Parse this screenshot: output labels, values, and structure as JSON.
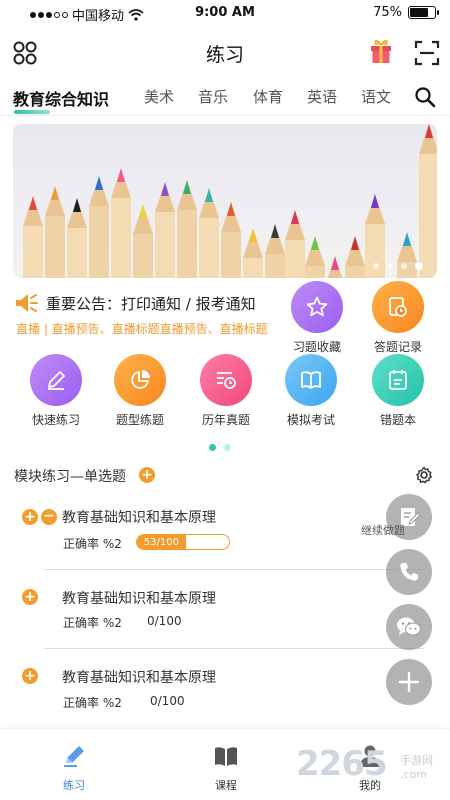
{
  "status_bar": {
    "carrier": "中国移动",
    "time": "9:00 AM",
    "battery": "75%"
  },
  "header": {
    "title": "练习"
  },
  "tabs": [
    {
      "label": "教育综合知识",
      "active": true
    },
    {
      "label": "美术"
    },
    {
      "label": "音乐"
    },
    {
      "label": "体育"
    },
    {
      "label": "英语"
    },
    {
      "label": "语文"
    }
  ],
  "banner": {
    "slides": 4,
    "active_slide": 4
  },
  "notice": {
    "text": "重要公告：打印通知 / 报考通知",
    "sub": "直播 | 直播预告、直播标题直播预告、直播标题"
  },
  "quick_actions": [
    {
      "label": "习题收藏",
      "icon": "star-icon",
      "color": "#a46cf0"
    },
    {
      "label": "答题记录",
      "icon": "record-icon",
      "color": "#f9962c"
    },
    {
      "label": "快速练习",
      "icon": "pencil-icon",
      "color": "#a46cf0"
    },
    {
      "label": "题型练题",
      "icon": "pie-chart-icon",
      "color": "#f9962c"
    },
    {
      "label": "历年真题",
      "icon": "history-icon",
      "color": "#f25d8c"
    },
    {
      "label": "模拟考试",
      "icon": "book-icon",
      "color": "#4fb4f3"
    },
    {
      "label": "错题本",
      "icon": "notebook-icon",
      "color": "#2fd0b6"
    }
  ],
  "section": {
    "title": "模块练习—单选题"
  },
  "practice_items": [
    {
      "title": "教育基础知识和基本原理",
      "rate": "正确率 %2",
      "count": "53/100",
      "progress": 0.53
    },
    {
      "title": "教育基础知识和基本原理",
      "rate": "正确率 %2",
      "count": "0/100"
    },
    {
      "title": "教育基础知识和基本原理",
      "rate": "正确率 %2",
      "count": "0/100"
    }
  ],
  "floating": {
    "continue_label": "继续做题"
  },
  "bottom_nav": [
    {
      "label": "练习",
      "active": true
    },
    {
      "label": "课程"
    },
    {
      "label": "我的"
    }
  ],
  "watermark": {
    "main": "2265",
    "sub": "手游网",
    "domain": ".com"
  },
  "colors": {
    "accent": "#3b7fe0",
    "orange": "#f39c2d",
    "teal": "#2bc7b0"
  }
}
